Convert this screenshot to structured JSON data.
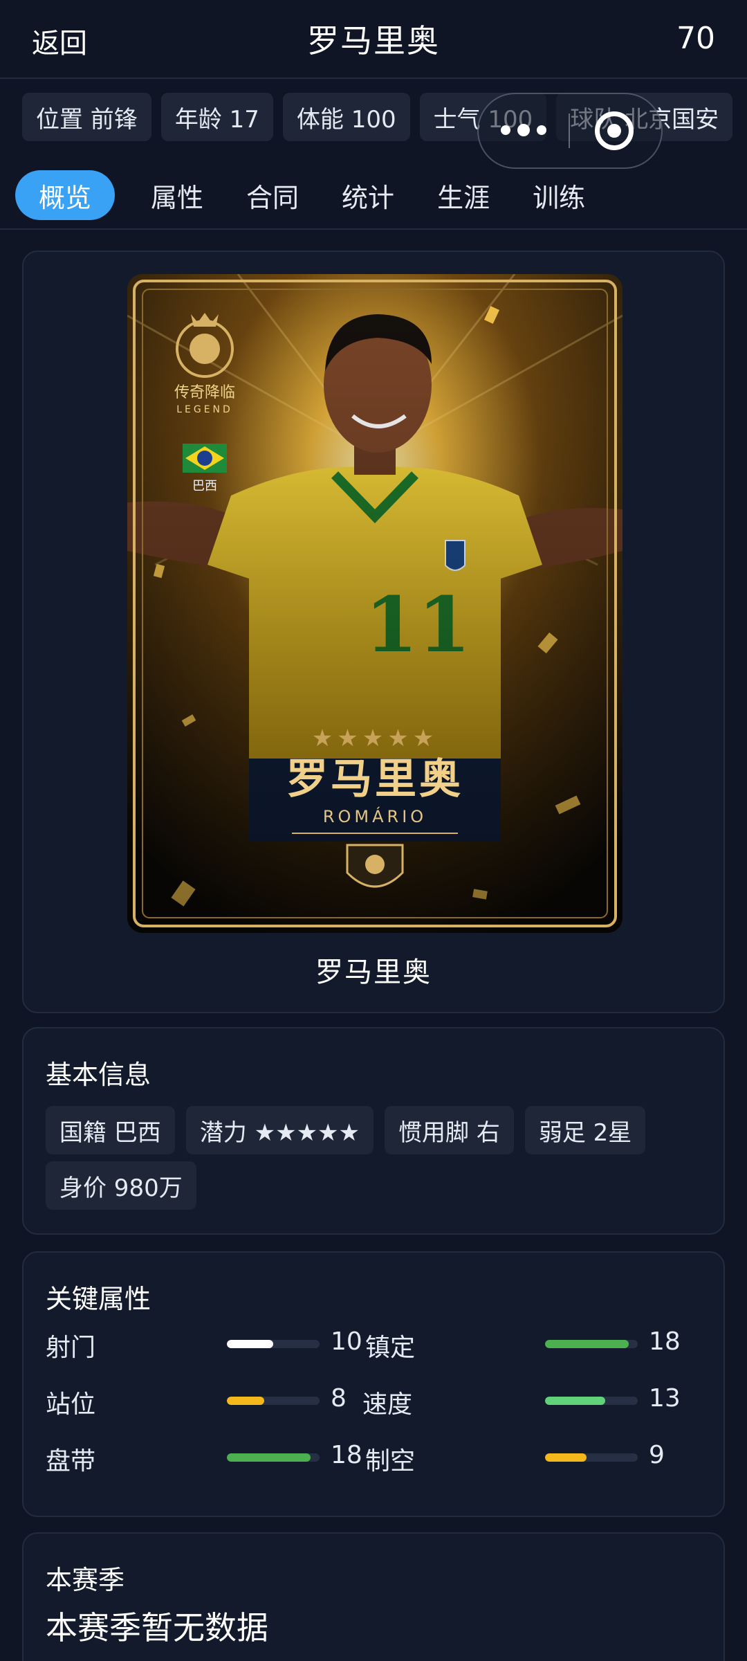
{
  "header": {
    "back_label": "返回",
    "title": "罗马里奥",
    "rating": "70"
  },
  "chips": [
    "位置 前锋",
    "年龄 17",
    "体能 100",
    "士气 100",
    "球队 北京国安"
  ],
  "tabs": [
    "概览",
    "属性",
    "合同",
    "统计",
    "生涯",
    "训练"
  ],
  "card": {
    "badge_cn": "传奇降临",
    "badge_en": "LEGEND",
    "country": "巴西",
    "stars": "★★★★★",
    "name_cn": "罗马里奥",
    "name_en": "ROMÁRIO",
    "number": "11",
    "caption": "罗马里奥"
  },
  "basic_info": {
    "title": "基本信息",
    "items": [
      "国籍 巴西",
      "潜力 ★★★★★",
      "惯用脚 右",
      "弱足 2星",
      "身价 980万"
    ]
  },
  "key_attrs": {
    "title": "关键属性",
    "items": [
      {
        "label": "射门",
        "value": "10",
        "fraction": 0.5,
        "color": "#ffffff"
      },
      {
        "label": "镇定",
        "value": "18",
        "fraction": 0.9,
        "color": "#4caf50"
      },
      {
        "label": "站位",
        "value": "8",
        "fraction": 0.4,
        "color": "#f5b81c"
      },
      {
        "label": "速度",
        "value": "13",
        "fraction": 0.65,
        "color": "#5fd27a"
      },
      {
        "label": "盘带",
        "value": "18",
        "fraction": 0.9,
        "color": "#4caf50"
      },
      {
        "label": "制空",
        "value": "9",
        "fraction": 0.45,
        "color": "#f5b81c"
      }
    ]
  },
  "season": {
    "title": "本赛季",
    "empty_text": "本赛季暂无数据"
  }
}
